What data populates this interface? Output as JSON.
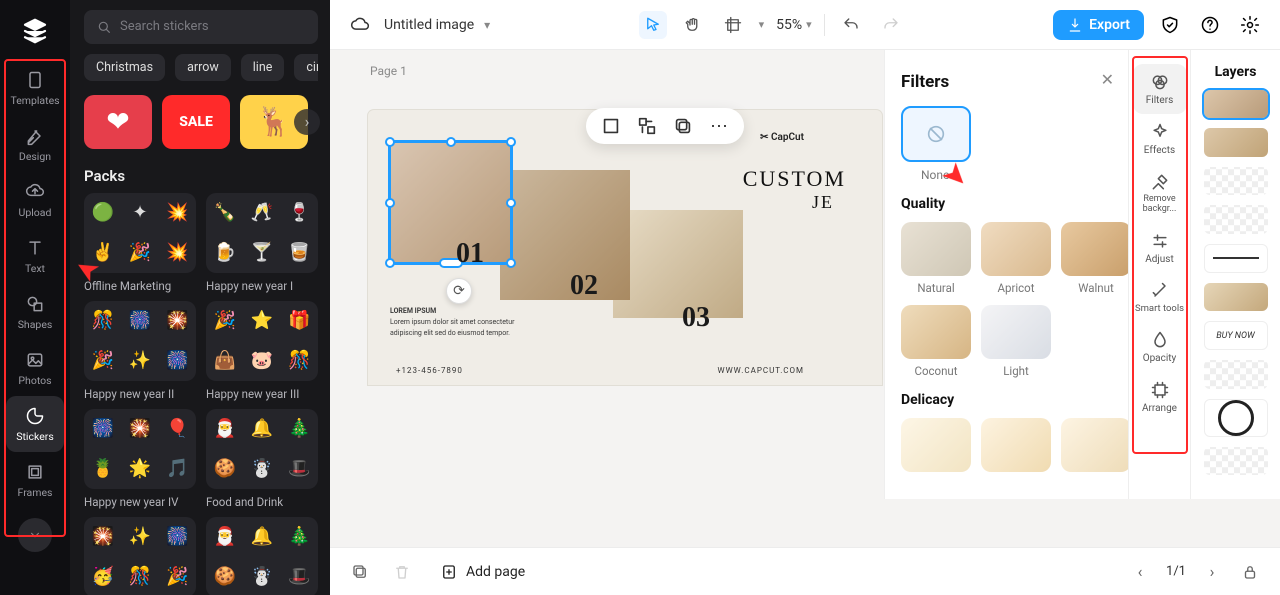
{
  "brand": "CapCut",
  "rail": [
    {
      "icon": "templates",
      "label": "Templates"
    },
    {
      "icon": "design",
      "label": "Design"
    },
    {
      "icon": "upload",
      "label": "Upload"
    },
    {
      "icon": "text",
      "label": "Text"
    },
    {
      "icon": "shapes",
      "label": "Shapes"
    },
    {
      "icon": "photos",
      "label": "Photos"
    },
    {
      "icon": "stickers",
      "label": "Stickers"
    },
    {
      "icon": "frames",
      "label": "Frames"
    }
  ],
  "rail_active_index": 6,
  "library": {
    "search_placeholder": "Search stickers",
    "chips": [
      "Christmas",
      "arrow",
      "line",
      "circle"
    ],
    "featured": [
      {
        "bg": "#e63e4b",
        "emoji": "❤"
      },
      {
        "bg": "#ff2a2a",
        "emoji": "SALE"
      },
      {
        "bg": "#ffd24a",
        "emoji": "🦌"
      }
    ],
    "packs_heading": "Packs",
    "packs": [
      [
        {
          "name": "Offline Marketing",
          "items": [
            "🟢",
            "✦",
            "💥",
            "✌️",
            "🎉",
            "💥"
          ]
        },
        {
          "name": "Happy new year I",
          "items": [
            "🍾",
            "🥂",
            "🍷",
            "🍺",
            "🍸",
            "🥃"
          ]
        }
      ],
      [
        {
          "name": "Happy new year II",
          "items": [
            "🎊",
            "🎆",
            "🎇",
            "🎉",
            "✨",
            "🎆"
          ]
        },
        {
          "name": "Happy new year III",
          "items": [
            "🎉",
            "⭐",
            "🎁",
            "👜",
            "🐷",
            "🎊"
          ]
        }
      ],
      [
        {
          "name": "Happy new year IV",
          "items": [
            "🎆",
            "🎇",
            "🎈",
            "🍍",
            "🌟",
            "🎵"
          ]
        },
        {
          "name": "Food and Drink",
          "items": [
            "🎅",
            "🔔",
            "🎄",
            "🍪",
            "☃️",
            "🎩"
          ]
        }
      ],
      [
        {
          "name": "",
          "items": [
            "🎇",
            "✨",
            "🎆",
            "🥳",
            "🎊",
            "🎉"
          ]
        },
        {
          "name": "",
          "items": [
            "🎅",
            "🔔",
            "🎄",
            "🍪",
            "☃️",
            "🎩"
          ]
        }
      ]
    ]
  },
  "header": {
    "title": "Untitled image",
    "zoom": "55%",
    "export_label": "Export"
  },
  "canvas": {
    "page_label": "Page 1",
    "brand_tag": "✂ CapCut",
    "headline_1": "CUSTOM",
    "headline_2": "JE",
    "numbers": [
      "01",
      "02",
      "03"
    ],
    "caption_title": "LOREM IPSUM",
    "caption_body": "Lorem ipsum dolor sit amet consectetur adipiscing elit sed do eiusmod tempor.",
    "footer_phone": "+123-456-7890",
    "footer_site": "WWW.CAPCUT.COM"
  },
  "filters_panel": {
    "title": "Filters",
    "none_label": "None",
    "sections": [
      {
        "title": "Quality",
        "items": [
          {
            "name": "Natural",
            "bg": "linear-gradient(135deg,#e8e1d4,#cfc7b5)"
          },
          {
            "name": "Apricot",
            "bg": "linear-gradient(135deg,#f0dcc1,#d9b98e)"
          },
          {
            "name": "Walnut",
            "bg": "linear-gradient(135deg,#e8c9a0,#c99f6b)"
          },
          {
            "name": "Coconut",
            "bg": "linear-gradient(135deg,#efdcbc,#d6b584)"
          },
          {
            "name": "Light",
            "bg": "linear-gradient(135deg,#f4f4f6,#d9dde4)"
          }
        ]
      },
      {
        "title": "Delicacy",
        "items": [
          {
            "name": "",
            "bg": "linear-gradient(135deg,#fdf6e6,#f2e4c3)"
          },
          {
            "name": "",
            "bg": "linear-gradient(135deg,#fdf3e0,#f0dbb1)"
          },
          {
            "name": "",
            "bg": "linear-gradient(135deg,#fdf4e3,#eedcb8)"
          }
        ]
      }
    ]
  },
  "right_tools": [
    {
      "label": "Filters",
      "icon": "filters"
    },
    {
      "label": "Effects",
      "icon": "sparkle"
    },
    {
      "label": "Remove backgr...",
      "icon": "eraser"
    },
    {
      "label": "Adjust",
      "icon": "sliders"
    },
    {
      "label": "Smart tools",
      "icon": "wand"
    },
    {
      "label": "Opacity",
      "icon": "droplet"
    },
    {
      "label": "Arrange",
      "icon": "arrange"
    }
  ],
  "right_tools_active_index": 0,
  "layers": {
    "title": "Layers",
    "items": [
      "sel",
      "img",
      "check",
      "check",
      "line",
      "img",
      "buy",
      "check",
      "circle",
      "check",
      "bar"
    ]
  },
  "bottom": {
    "add_page": "Add page",
    "pager": "1/1"
  }
}
